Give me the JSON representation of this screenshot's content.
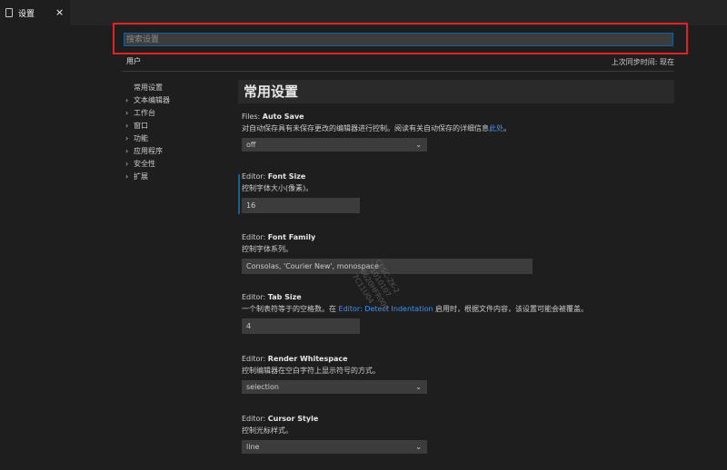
{
  "tab": {
    "label": "设置",
    "close": "×"
  },
  "search": {
    "placeholder": "搜索设置",
    "value": ""
  },
  "scope_tab": "用户",
  "sync_status": "上次同步时间: 现在",
  "toc": [
    {
      "label": "常用设置",
      "chevron": ""
    },
    {
      "label": "文本编辑器",
      "chevron": "›"
    },
    {
      "label": "工作台",
      "chevron": "›"
    },
    {
      "label": "窗口",
      "chevron": "›"
    },
    {
      "label": "功能",
      "chevron": "›"
    },
    {
      "label": "应用程序",
      "chevron": "›"
    },
    {
      "label": "安全性",
      "chevron": "›"
    },
    {
      "label": "扩展",
      "chevron": "›"
    }
  ],
  "section_title": "常用设置",
  "settings": {
    "auto_save": {
      "category": "Files: ",
      "name": "Auto Save",
      "desc_pre": "对自动保存具有未保存更改的编辑器进行控制。阅读有关自动保存的详细信息",
      "desc_link": "此处",
      "desc_post": "。",
      "value": "off"
    },
    "font_size": {
      "category": "Editor: ",
      "name": "Font Size",
      "desc": "控制字体大小(像素)。",
      "value": "16"
    },
    "font_family": {
      "category": "Editor: ",
      "name": "Font Family",
      "desc": "控制字体系列。",
      "value": "Consolas, 'Courier New', monospace"
    },
    "tab_size": {
      "category": "Editor: ",
      "name": "Tab Size",
      "desc_pre": "一个制表符等于的空格数。在 ",
      "desc_link": "Editor: Detect Indentation",
      "desc_post": " 启用时，根据文件内容，该设置可能会被覆盖。",
      "value": "4"
    },
    "render_whitespace": {
      "category": "Editor: ",
      "name": "Render Whitespace",
      "desc": "控制编辑器在空白字符上显示符号的方式。",
      "value": "selection"
    },
    "cursor_style": {
      "category": "Editor: ",
      "name": "Cursor Style",
      "desc": "控制光标样式。",
      "value": "line"
    }
  },
  "select_arrow": "⌄",
  "watermark": [
    "CESC-ZK-2",
    "01010107",
    "8620HFR000",
    "7C11U04"
  ]
}
